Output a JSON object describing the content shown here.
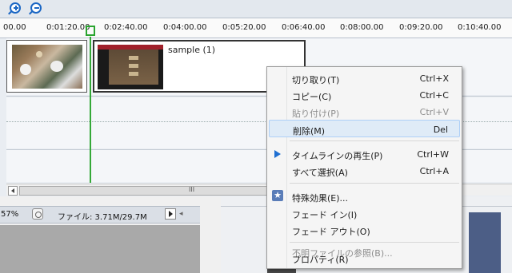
{
  "ruler": {
    "ticks": [
      "00.00",
      "0:01:20.00",
      "0:02:40.00",
      "0:04:00.00",
      "0:05:20.00",
      "0:06:40.00",
      "0:08:00.00",
      "0:09:20.00",
      "0:10:40.00"
    ]
  },
  "timeline": {
    "clip2_name": "sample (1)"
  },
  "statusbar": {
    "zoom_pct": "57%",
    "file_size": "ファイル: 3.71M/29.7M",
    "scroll_grip": "III"
  },
  "context_menu": {
    "items": [
      {
        "label": "切り取り(T)",
        "shortcut": "Ctrl+X",
        "enabled": true
      },
      {
        "label": "コピー(C)",
        "shortcut": "Ctrl+C",
        "enabled": true
      },
      {
        "label": "貼り付け(P)",
        "shortcut": "Ctrl+V",
        "enabled": false
      },
      {
        "label": "削除(M)",
        "shortcut": "Del",
        "enabled": true,
        "highlighted": true
      },
      {
        "label": "タイムラインの再生(P)",
        "shortcut": "Ctrl+W",
        "enabled": true,
        "icon": "play-icon"
      },
      {
        "label": "すべて選択(A)",
        "shortcut": "Ctrl+A",
        "enabled": true
      },
      {
        "label": "特殊効果(E)...",
        "shortcut": "",
        "enabled": true,
        "icon": "star-icon"
      },
      {
        "label": "フェード イン(I)",
        "shortcut": "",
        "enabled": true
      },
      {
        "label": "フェード アウト(O)",
        "shortcut": "",
        "enabled": true
      },
      {
        "label": "不明ファイルの参照(B)...",
        "shortcut": "",
        "enabled": false
      },
      {
        "label": "プロパティ(R)",
        "shortcut": "",
        "enabled": true
      }
    ]
  },
  "colors": {
    "playhead": "#34a838",
    "highlight": "#dfebf7",
    "accent": "#1a66c4"
  }
}
